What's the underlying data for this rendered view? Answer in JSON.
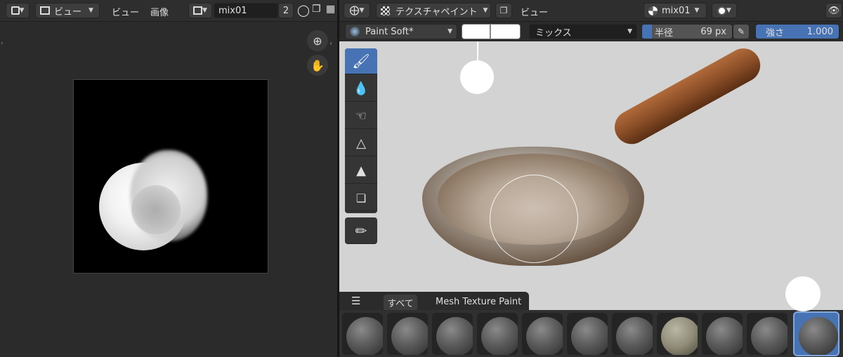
{
  "left_editor": {
    "header": {
      "view_menu": "ビュー",
      "view_menu2": "ビュー",
      "image_menu": "画像",
      "image_name": "mix01",
      "users_count": "2"
    }
  },
  "right_editor": {
    "header": {
      "mode": "テクスチャペイント",
      "view_menu": "ビュー",
      "material": "mix01"
    },
    "tool_settings": {
      "brush_name": "Paint Soft*",
      "blend_mode": "ミックス",
      "radius_label": "半径",
      "radius_value": "69 px",
      "strength_label": "強さ",
      "strength_value": "1.000"
    },
    "tabs": [
      {
        "label": "すべて"
      },
      {
        "label": "Mesh Texture Paint"
      }
    ]
  },
  "colors": {
    "accent": "#4772b3",
    "panel": "#2b2b2b",
    "header": "#2e2e2e",
    "viewport": "#d4d3d3"
  }
}
